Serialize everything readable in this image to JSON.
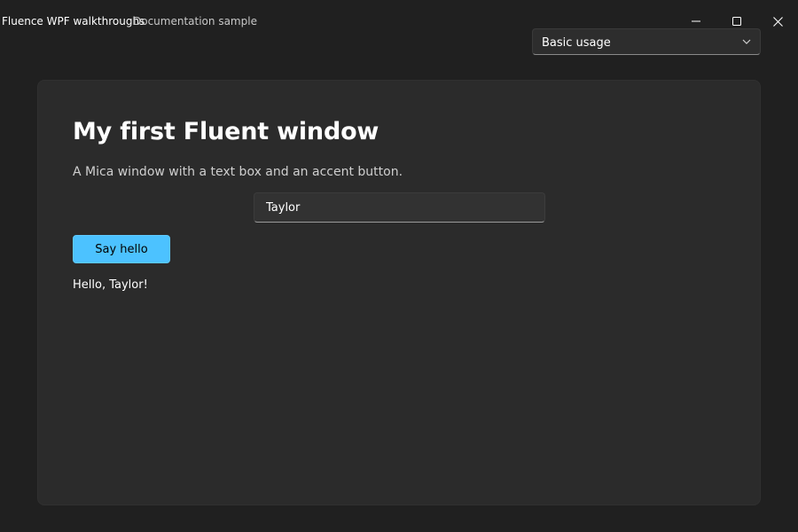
{
  "window": {
    "title": "Fluence WPF walkthroughs",
    "subtitle": "Documentation sample",
    "caption_buttons": [
      "minimize-icon",
      "maximize-icon",
      "close-icon"
    ]
  },
  "walkthrough_select": {
    "selected": "Basic usage",
    "icon": "chevron-down-icon"
  },
  "main": {
    "title": "My first Fluent window",
    "description": "A Mica window with a text box and an accent button.",
    "name_input": {
      "value": "Taylor",
      "placeholder": ""
    },
    "button_label": "Say hello",
    "greeting": "Hello, Taylor!"
  },
  "colors": {
    "background": "#202020",
    "card": "#2b2b2b",
    "accent": "#4cc2ff",
    "text": "#ffffff",
    "secondary_text": "#cfcfcf"
  }
}
